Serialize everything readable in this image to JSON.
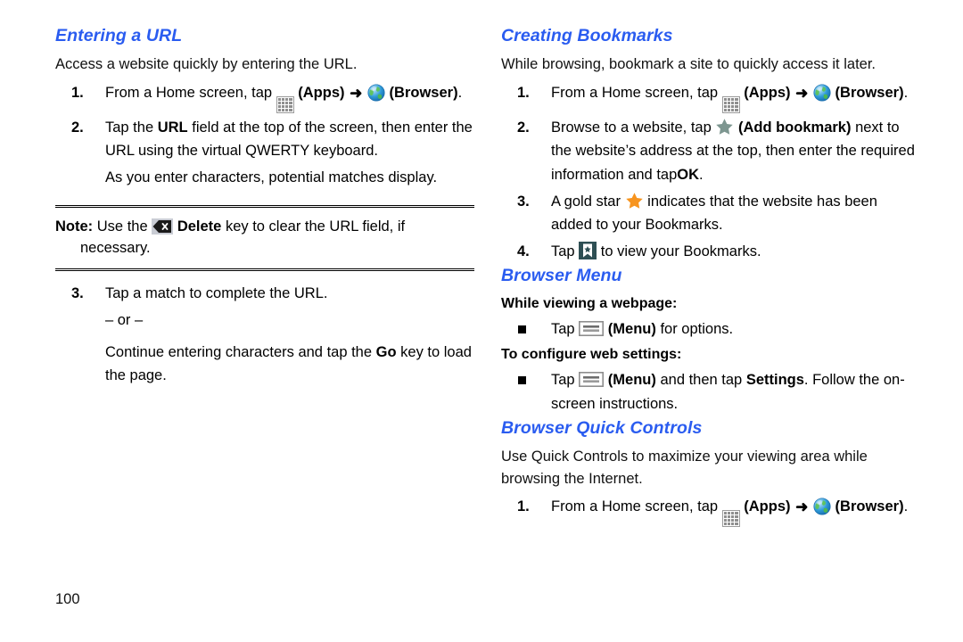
{
  "document": {
    "page_number": "100",
    "heading_color": "#2a5cf0"
  },
  "left_column": {
    "section1": {
      "title": "Entering a URL",
      "intro": "Access a website quickly by entering the URL.",
      "steps": [
        {
          "num": "1.",
          "part1": "From a Home screen, tap",
          "icon1": "apps-grid-icon",
          "label1": "(Apps)",
          "arrow": "➜",
          "icon2": "browser-globe-icon",
          "label2": "(Browser)",
          "tail": "."
        },
        {
          "num": "2.",
          "part1": "Tap the",
          "bold1": "URL",
          "part2": "field at the top of the screen, then enter the URL using the virtual QWERTY keyboard.",
          "follow": "As you enter characters, potential matches display."
        },
        {
          "num": "3.",
          "part1": "Tap a match to complete the URL.",
          "or": "– or –",
          "follow_pre": "Continue entering characters and tap the",
          "follow_bold": "Go",
          "follow_post": "key to load the page."
        }
      ],
      "note": {
        "label": "Note:",
        "pre": "Use the",
        "icon": "delete-key-icon",
        "bold": "Delete",
        "post": "key to clear the URL field, if",
        "line2": "necessary."
      }
    }
  },
  "right_column": {
    "section2": {
      "title": "Creating Bookmarks",
      "intro": "While browsing, bookmark a site to quickly access it later.",
      "steps": [
        {
          "num": "1.",
          "part1": "From a Home screen, tap",
          "icon1": "apps-grid-icon",
          "label1": "(Apps)",
          "arrow": "➜",
          "icon2": "browser-globe-icon",
          "label2": "(Browser)",
          "tail": "."
        },
        {
          "num": "2.",
          "part1": "Browse to a website, tap",
          "icon1": "add-bookmark-star-icon",
          "label1": "(Add bookmark)",
          "part2": "next to the website’s address at the top, then enter the required information and tap",
          "bold1": "OK",
          "tail": "."
        },
        {
          "num": "3.",
          "part1": "A gold star",
          "icon1": "gold-star-icon",
          "part2": "indicates that the website has been added to your Bookmarks."
        },
        {
          "num": "4.",
          "part1": "Tap",
          "icon1": "bookmarks-view-icon",
          "part2": "to view your Bookmarks."
        }
      ]
    },
    "section3": {
      "title": "Browser Menu",
      "subhead1": "While viewing a webpage:",
      "bullet1": {
        "pre": "Tap",
        "icon": "menu-icon",
        "label": "(Menu)",
        "post": "for options."
      },
      "subhead2": "To configure web settings:",
      "bullet2": {
        "pre": "Tap",
        "icon": "menu-icon",
        "label": "(Menu)",
        "mid": "and then tap",
        "bold": "Settings",
        "post": ". Follow the on-screen instructions."
      }
    },
    "section4": {
      "title": "Browser Quick Controls",
      "intro": "Use Quick Controls to maximize your viewing area while browsing the Internet.",
      "steps": [
        {
          "num": "1.",
          "part1": "From a Home screen, tap",
          "icon1": "apps-grid-icon",
          "label1": "(Apps)",
          "arrow": "➜",
          "icon2": "browser-globe-icon",
          "label2": "(Browser)",
          "tail": "."
        }
      ]
    }
  }
}
